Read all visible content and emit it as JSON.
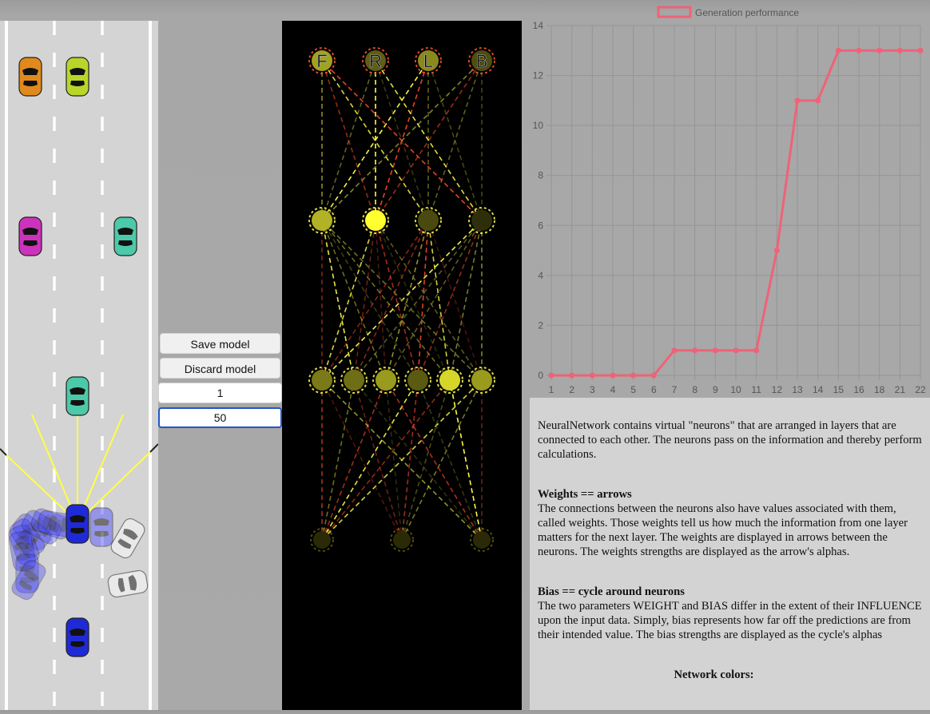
{
  "controls": {
    "save_label": "Save model",
    "discard_label": "Discard model",
    "mutation_value": "1",
    "cars_value": "50"
  },
  "network": {
    "output_labels": [
      "F",
      "R",
      "L",
      "B"
    ],
    "arrow_colors": [
      "#ffff44",
      "#ff4a2a",
      "#7b7b2a"
    ]
  },
  "chart_data": {
    "type": "line",
    "title": "",
    "legend": [
      "Generation performance"
    ],
    "legend_position": "top",
    "categories": [
      "1",
      "2",
      "3",
      "4",
      "5",
      "6",
      "7",
      "8",
      "9",
      "10",
      "11",
      "12",
      "13",
      "14",
      "15",
      "16",
      "18",
      "21",
      "22"
    ],
    "series": [
      {
        "name": "Generation performance",
        "values": [
          0,
          0,
          0,
          0,
          0,
          0,
          1,
          1,
          1,
          1,
          1,
          5,
          11,
          11,
          13,
          13,
          13,
          13,
          13
        ],
        "color": "#ee6377"
      }
    ],
    "xlabel": "",
    "ylabel": "",
    "ylim": [
      0,
      14
    ],
    "yticks": [
      0,
      2,
      4,
      6,
      8,
      10,
      12,
      14
    ],
    "grid": true
  },
  "info": {
    "intro": "NeuralNetwork contains virtual \"neurons\" that are arranged in layers that are connected to each other. The neurons pass on the information and thereby perform calculations.",
    "weights_heading": "Weights == arrows",
    "weights_text": "The connections between the neurons also have values associated with them, called weights. Those weights tell us how much the information from one layer matters for the next layer. The weights are displayed in arrows between the neurons. The weights strengths are displayed as the arrow's alphas.",
    "bias_heading": "Bias == cycle around neurons",
    "bias_text": "The two parameters WEIGHT and BIAS differ in the extent of their INFLUENCE upon the input data. Simply, bias represents how far off the predictions are from their intended value. The bias strengths are displayed as the cycle's alphas",
    "colors_heading": "Network colors:"
  },
  "cars": {
    "colors": [
      "#e08a1e",
      "#b8d62a",
      "#cc33bb",
      "#4cc9a8",
      "#4cc9a8",
      "#1f2ad6",
      "#1f2ad6"
    ]
  }
}
